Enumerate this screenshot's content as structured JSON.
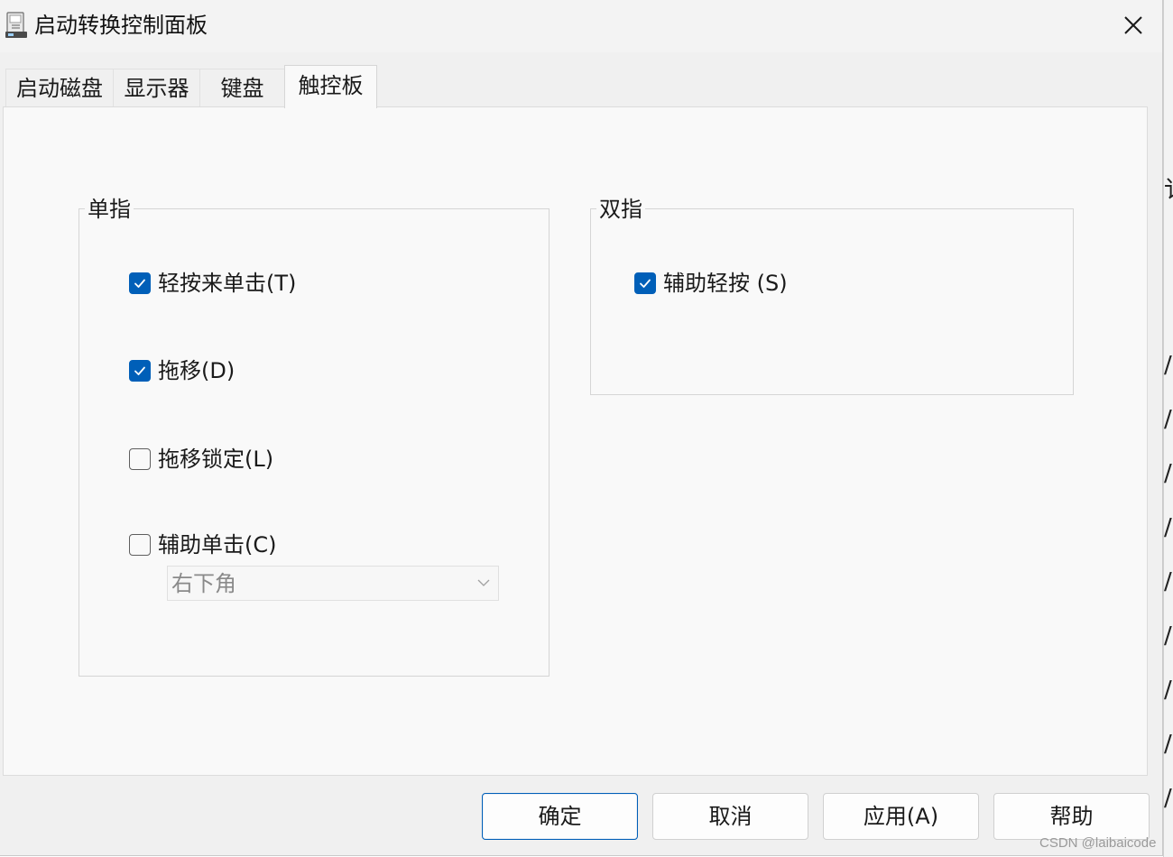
{
  "window": {
    "title": "启动转换控制面板",
    "close_label": "×"
  },
  "tabs": [
    {
      "label": "启动磁盘"
    },
    {
      "label": "显示器"
    },
    {
      "label": "键盘"
    },
    {
      "label": "触控板",
      "active": true
    }
  ],
  "one_finger": {
    "group_label": "单指",
    "tap_to_click": {
      "label": "轻按来单击(T)",
      "checked": true
    },
    "drag": {
      "label": "拖移(D)",
      "checked": true
    },
    "drag_lock": {
      "label": "拖移锁定(L)",
      "checked": false
    },
    "secondary_click": {
      "label": "辅助单击(C)",
      "checked": false
    },
    "secondary_click_corner": {
      "value": "右下角",
      "enabled": false
    }
  },
  "two_finger": {
    "group_label": "双指",
    "secondary_tap": {
      "label": "辅助轻按 (S)",
      "checked": true
    }
  },
  "buttons": {
    "ok": "确定",
    "cancel": "取消",
    "apply": "应用(A)",
    "help": "帮助"
  },
  "watermark": "CSDN @laibaicode",
  "colors": {
    "accent": "#005fb8",
    "panel": "#f9f9f9",
    "window": "#f0f0f0"
  }
}
